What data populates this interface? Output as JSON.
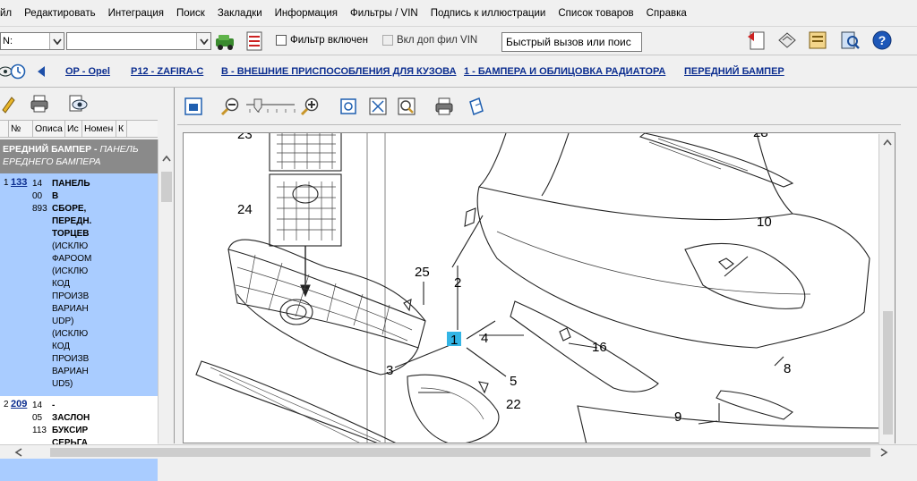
{
  "menu": {
    "items": [
      "йл",
      "Редактировать",
      "Интеграция",
      "Поиск",
      "Закладки",
      "Информация",
      "Фильтры / VIN",
      "Подпись к иллюстрации",
      "Список товаров",
      "Справка"
    ]
  },
  "toolbar": {
    "vin_combo_value": "N:",
    "second_combo_value": "",
    "filter_enabled_label": "Фильтр включен",
    "extra_vin_filter_label": "Вкл доп фил VIN",
    "quick_call_placeholder": "Быстрый вызов или поис"
  },
  "breadcrumb": {
    "items": [
      "OP - Opel",
      "P12 - ZAFIRA-C",
      "B - ВНЕШНИЕ ПРИСПОСОБЛЕНИЯ ДЛЯ КУЗОВА",
      "1 - БАМПЕРА И ОБЛИЦОВКА РАДИАТОРА",
      "ПЕРЕДНИЙ БАМПЕР"
    ]
  },
  "parts_table": {
    "columns": [
      "",
      "№",
      "Описа",
      "Ис",
      "Номен",
      "К"
    ],
    "group_header_main": "ЕРЕДНИЙ БАМПЕР - ",
    "group_header_italic_1": "ПАНЕЛЬ",
    "group_header_italic_2": "ЕРЕДНЕГО БАМПЕРА",
    "rows": [
      {
        "index": "1",
        "ref": "133",
        "code_lines": [
          "14",
          "00",
          "893"
        ],
        "description_bold": [
          "ПАНЕЛЬ",
          "В",
          "СБОРЕ,",
          "ПЕРЕДН.",
          "ТОРЦЕВ"
        ],
        "description_notes": [
          "(ИСКЛЮ",
          "ФАРООМ",
          "(ИСКЛЮ",
          "КОД",
          "ПРОИЗВ",
          "ВАРИАН",
          "UDP)",
          "(ИСКЛЮ",
          "КОД",
          "ПРОИЗВ",
          "ВАРИАН",
          "UD5)"
        ]
      },
      {
        "index": "2",
        "ref": "209",
        "code_lines": [
          "14",
          "05",
          "113"
        ],
        "description_bold": [
          "-",
          "ЗАСЛОН",
          "БУКСИР",
          "СЕРЬГА"
        ]
      }
    ]
  },
  "drawing": {
    "callouts": [
      "23",
      "24",
      "25",
      "2",
      "1",
      "4",
      "3",
      "5",
      "22",
      "16",
      "10",
      "8",
      "9",
      "28"
    ],
    "highlighted_callout": "1"
  },
  "colors": {
    "selection": "#a9ccff",
    "link": "#0b2d8f",
    "highlight": "#33b5e5",
    "group_header": "#8a8a8a"
  }
}
